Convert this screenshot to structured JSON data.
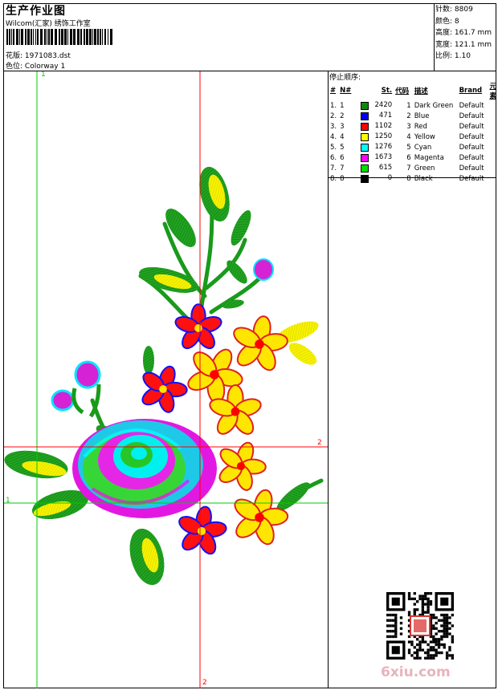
{
  "header": {
    "title": "生产作业图",
    "company": "Wilcom(汇家) 绣饰工作室",
    "design_label": "花版:",
    "design_value": "1971083.dst",
    "colorway_label": "色位:",
    "colorway_value": "Colorway 1"
  },
  "stats": {
    "stitches": "针数: 8809",
    "colors": "颜色: 8",
    "height": "高度: 161.7 mm",
    "width": "宽度: 121.1 mm",
    "scale": "比例: 1.10"
  },
  "stop_sequence": {
    "label": "停止顺序:",
    "headers": [
      "#",
      "N#",
      "St.",
      "代码",
      "描述",
      "Brand",
      "元素"
    ],
    "rows": [
      {
        "idx": "1.",
        "n": "1",
        "color": "#0a8a0a",
        "st": "2420",
        "code": "1",
        "desc": "Dark Green",
        "brand": "Default"
      },
      {
        "idx": "2.",
        "n": "2",
        "color": "#0000ff",
        "st": "471",
        "code": "2",
        "desc": "Blue",
        "brand": "Default"
      },
      {
        "idx": "3.",
        "n": "3",
        "color": "#ff0000",
        "st": "1102",
        "code": "3",
        "desc": "Red",
        "brand": "Default"
      },
      {
        "idx": "4.",
        "n": "4",
        "color": "#ffff00",
        "st": "1250",
        "code": "4",
        "desc": "Yellow",
        "brand": "Default"
      },
      {
        "idx": "5.",
        "n": "5",
        "color": "#00ffff",
        "st": "1276",
        "code": "5",
        "desc": "Cyan",
        "brand": "Default"
      },
      {
        "idx": "6.",
        "n": "6",
        "color": "#ff00ff",
        "st": "1673",
        "code": "6",
        "desc": "Magenta",
        "brand": "Default"
      },
      {
        "idx": "7.",
        "n": "7",
        "color": "#00dd00",
        "st": "615",
        "code": "7",
        "desc": "Green",
        "brand": "Default"
      },
      {
        "idx": "8.",
        "n": "8",
        "color": "#000000",
        "st": "0",
        "code": "8",
        "desc": "Black",
        "brand": "Default"
      }
    ]
  },
  "guides": {
    "v1": "1",
    "h1": "1",
    "v2": "2",
    "h2": "2",
    "green_color": "#00cc00",
    "red_color": "#ff0000"
  },
  "watermark": "6xiu.com"
}
